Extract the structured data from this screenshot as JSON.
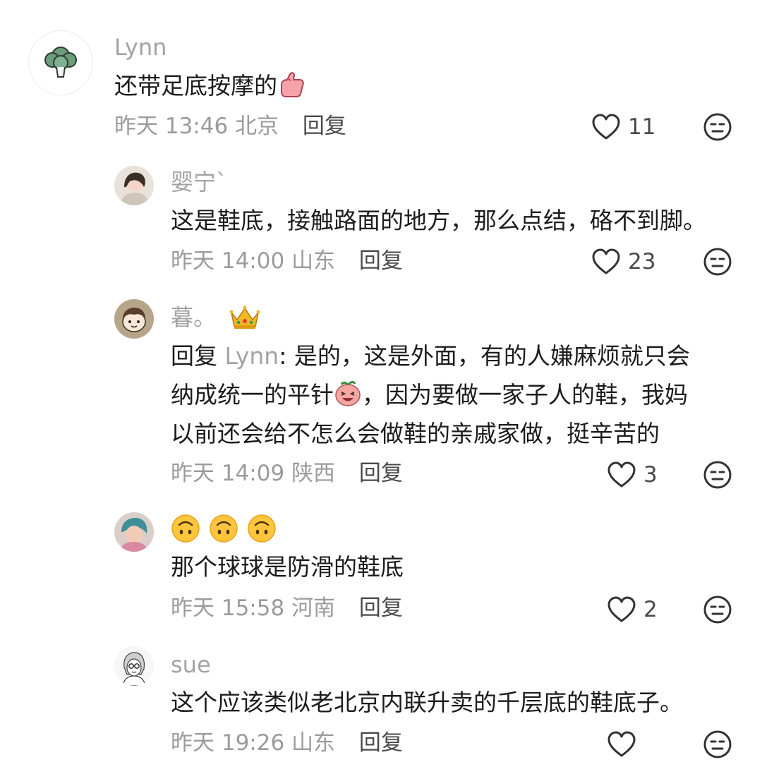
{
  "comments": [
    {
      "username": "Lynn",
      "text": "还带足底按摩的",
      "time": "昨天 13:46",
      "location": "北京",
      "reply_label": "回复",
      "likes": "11",
      "avatar_icon": "broccoli-icon",
      "text_emoji": "thumbs-up-emoji"
    },
    {
      "username": "婴宁`",
      "text": "这是鞋底，接触路面的地方，那么点结，硌不到脚。",
      "time": "昨天 14:00",
      "location": "山东",
      "reply_label": "回复",
      "likes": "23"
    },
    {
      "username": "暮。",
      "username_badge": "crown-icon",
      "reply_prefix": "回复 ",
      "reply_to": "Lynn",
      "reply_suffix": ": 是的，这是外面，有的人嫌麻烦就只会",
      "text_line2a": "纳成统一的平针",
      "text_line2b": "，因为要做一家子人的鞋，我妈",
      "text_line3": "以前还会给不怎么会做鞋的亲戚家做，挺辛苦的",
      "time": "昨天 14:09",
      "location": "陕西",
      "reply_label": "回复",
      "likes": "3",
      "text_emoji": "laughing-peach-emoji"
    },
    {
      "username_emoji": "upside-down-face-emoji",
      "text": "那个球球是防滑的鞋底",
      "time": "昨天 15:58",
      "location": "河南",
      "reply_label": "回复",
      "likes": "2"
    },
    {
      "username": "sue",
      "text": "这个应该类似老北京内联升卖的千层底的鞋底子。",
      "time": "昨天 19:26",
      "location": "山东",
      "reply_label": "回复",
      "likes": ""
    }
  ],
  "colors": {
    "username": "#a3a3a3",
    "meta": "#9b9b9b",
    "text": "#1c1c1c",
    "icon": "#333333"
  }
}
